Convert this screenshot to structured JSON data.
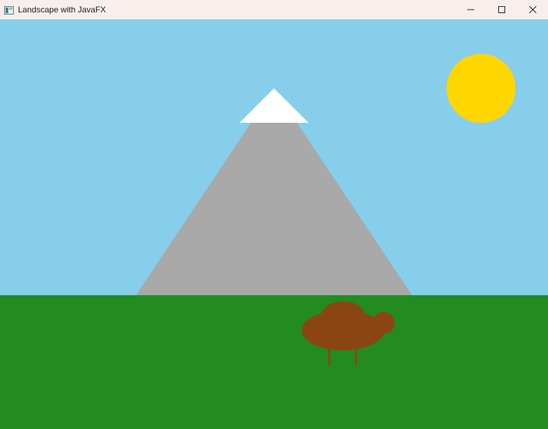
{
  "window": {
    "title": "Landscape with JavaFX",
    "icon": "java-app-icon",
    "controls": {
      "minimize_icon": "minimize-icon",
      "maximize_icon": "maximize-icon",
      "close_icon": "close-icon"
    }
  },
  "colors": {
    "titlebar": "#f8efec",
    "sky": "#87ceeb",
    "grass": "#228b22",
    "mountain": "#a9a9a9",
    "snow": "#ffffff",
    "sun": "#ffd700",
    "animal": "#8b4513"
  },
  "scene": {
    "elements": [
      "sky",
      "sun",
      "mountain",
      "snow-cap",
      "grass",
      "animal-body",
      "animal-head",
      "animal-legs"
    ]
  }
}
